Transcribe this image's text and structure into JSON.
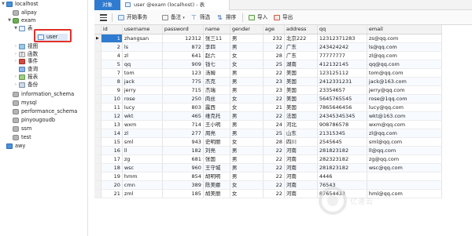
{
  "navigator": {
    "items": [
      {
        "label": "localhost",
        "level": 0,
        "icon": "server-icon",
        "expanded": true
      },
      {
        "label": "alipay",
        "level": 1,
        "icon": "database-icon"
      },
      {
        "label": "exam",
        "level": 1,
        "icon": "database-icon",
        "expanded": true
      },
      {
        "label": "表",
        "level": 2,
        "icon": "folder-icon",
        "expanded": true
      },
      {
        "label": "user",
        "level": 3,
        "icon": "table-icon",
        "selected": true
      },
      {
        "label": "视图",
        "level": 2,
        "icon": "view-icon"
      },
      {
        "label": "函数",
        "level": 2,
        "icon": "function-icon"
      },
      {
        "label": "事件",
        "level": 2,
        "icon": "event-icon"
      },
      {
        "label": "查询",
        "level": 2,
        "icon": "query-icon"
      },
      {
        "label": "报表",
        "level": 2,
        "icon": "report-icon"
      },
      {
        "label": "备份",
        "level": 2,
        "icon": "backup-icon"
      },
      {
        "label": "information_schema",
        "level": 1,
        "icon": "database-icon"
      },
      {
        "label": "mysql",
        "level": 1,
        "icon": "database-icon"
      },
      {
        "label": "performance_schema",
        "level": 1,
        "icon": "database-icon"
      },
      {
        "label": "pinyougoudb",
        "level": 1,
        "icon": "database-icon"
      },
      {
        "label": "ssm",
        "level": 1,
        "icon": "database-icon"
      },
      {
        "label": "test",
        "level": 1,
        "icon": "database-icon"
      },
      {
        "label": "awy",
        "level": 0,
        "icon": "server-icon"
      }
    ]
  },
  "tabs": {
    "objects_label": "对象",
    "active_label": "user @exam (localhost) - 表"
  },
  "toolbar": {
    "begin_transaction": "开始事务",
    "memo": "备注",
    "filter": "筛选",
    "sort": "排序",
    "import": "导入",
    "export": "导出"
  },
  "table": {
    "columns": [
      "id",
      "username",
      "password",
      "name",
      "gender",
      "age",
      "address",
      "qq",
      "email"
    ],
    "rows": [
      [
        "1",
        "zhangsan",
        "12312",
        "张三11",
        "男",
        "232",
        "北京222",
        "12312371283",
        "zs@qq.com"
      ],
      [
        "2",
        "ls",
        "872",
        "李四",
        "男",
        "22",
        "广东",
        "243424242",
        "ls@qq.com"
      ],
      [
        "4",
        "zl",
        "641",
        "赵六",
        "女",
        "28",
        "广东",
        "77777777",
        "zl@qq.com"
      ],
      [
        "5",
        "qq",
        "909",
        "钱七",
        "女",
        "25",
        "湖南",
        "412132145",
        "qq@qq.com"
      ],
      [
        "7",
        "tom",
        "123",
        "汤姆",
        "男",
        "22",
        "美国",
        "123125112",
        "tom@qq.com"
      ],
      [
        "8",
        "jack",
        "775",
        "杰克",
        "男",
        "23",
        "美国",
        "2412331231",
        "jack@163.com"
      ],
      [
        "9",
        "jerry",
        "715",
        "杰瑞",
        "男",
        "23",
        "美国",
        "23354657",
        "jerry@qq.com"
      ],
      [
        "10",
        "rose",
        "250",
        "肉丝",
        "女",
        "22",
        "美国",
        "5645765545",
        "rose@1qq.com"
      ],
      [
        "11",
        "lucy",
        "803",
        "露西",
        "女",
        "21",
        "美国",
        "7865646456",
        "lucy@qq.com"
      ],
      [
        "12",
        "wkt",
        "465",
        "维克托",
        "男",
        "22",
        "法国",
        "24345345345",
        "wkt@163.com"
      ],
      [
        "13",
        "wxm",
        "714",
        "王小明",
        "男",
        "24",
        "河北",
        "908786578",
        "wxm@qq.com"
      ],
      [
        "14",
        "zl",
        "277",
        "周亮",
        "男",
        "25",
        "山东",
        "21315345",
        "zl@qq.com"
      ],
      [
        "15",
        "sml",
        "943",
        "史明丽",
        "女",
        "28",
        "四川",
        "2545645",
        "sml@qq.com"
      ],
      [
        "16",
        "ll",
        "182",
        "刘亮",
        "男",
        "22",
        "河南",
        "281823182",
        "ll@qq.com"
      ],
      [
        "17",
        "zg",
        "681",
        "张国",
        "男",
        "22",
        "河南",
        "282323182",
        "zg@qq.com"
      ],
      [
        "18",
        "wsc",
        "960",
        "王守城",
        "男",
        "22",
        "河南",
        "281823182",
        "wsc@qq.com"
      ],
      [
        "19",
        "hmm",
        "854",
        "胡明明",
        "男",
        "22",
        "河南",
        "4446",
        ""
      ],
      [
        "20",
        "cmn",
        "389",
        "陈美娜",
        "女",
        "22",
        "河南",
        "76543",
        ""
      ],
      [
        "21",
        "zml",
        "185",
        "胡美丽",
        "女",
        "22",
        "河南",
        "87654433",
        "hml@qq.com"
      ]
    ]
  },
  "watermark": {
    "text": "亿速云"
  },
  "colors": {
    "accent": "#2e7bcf",
    "highlight_box": "#e0312a"
  }
}
